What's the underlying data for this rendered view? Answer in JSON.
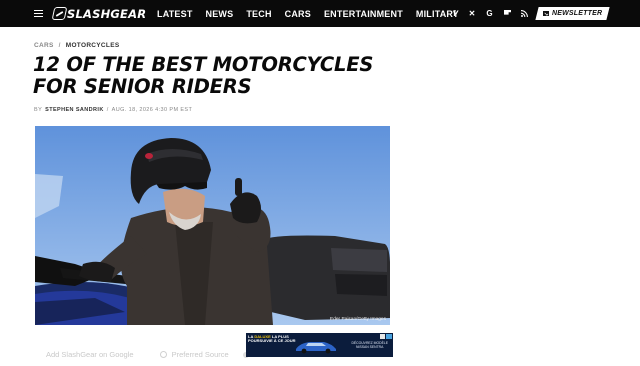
{
  "site": {
    "logo_text": "SLASHGEAR",
    "nav": [
      "LATEST",
      "NEWS",
      "TECH",
      "CARS",
      "ENTERTAINMENT",
      "MILITARY"
    ],
    "social_icons": [
      "facebook-icon",
      "x-icon",
      "google-icon",
      "flipboard-icon",
      "rss-icon"
    ],
    "newsletter_label": "NEWSLETTER"
  },
  "breadcrumb": [
    "CARS",
    "MOTORCYCLES"
  ],
  "article": {
    "title": "12 OF THE BEST MOTORCYCLES FOR SENIOR RIDERS",
    "by_prefix": "BY",
    "author": "STEPHEN SANDRIK",
    "date": "AUG. 18, 2026 4:30 PM EST",
    "image_credit": "Eder Paisan/Getty Images"
  },
  "follow": {
    "add_label": "Add SlashGear on Google",
    "preferred_label": "Preferred Source"
  },
  "ad": {
    "line1": "LA",
    "brand": "DALUXE",
    "line1_rest": "LA PLUS",
    "line2": "POURSUIVIE À CE JOUR",
    "cta1": "DÉCOUVREZ MODÈLE",
    "cta2": "NISSAN SENTRA"
  },
  "colors": {
    "topbar": "#0a0a0a",
    "title": "#0a0a0a",
    "sky": "#6fa0e0"
  }
}
